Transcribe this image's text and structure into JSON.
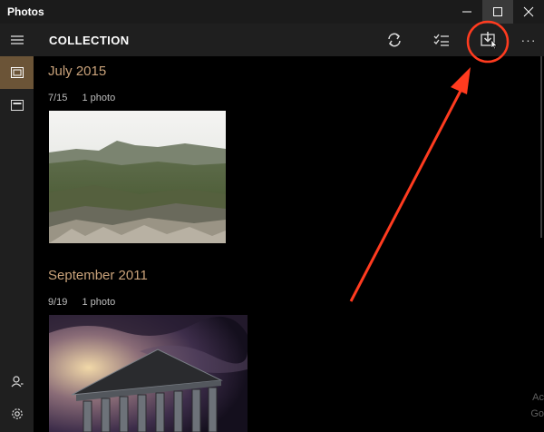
{
  "app": {
    "title": "Photos"
  },
  "header": {
    "title": "COLLECTION"
  },
  "toolbar": {
    "refresh_icon": "refresh-icon",
    "select_icon": "select-list-icon",
    "import_icon": "import-icon",
    "more_label": "···"
  },
  "sidebar": {
    "items": [
      {
        "icon": "collection-icon",
        "selected": true
      },
      {
        "icon": "albums-icon",
        "selected": false
      },
      {
        "icon": "account-icon",
        "selected": false
      },
      {
        "icon": "settings-icon",
        "selected": false
      }
    ]
  },
  "groups": [
    {
      "title": "July 2015",
      "date": "7/15",
      "count": "1 photo"
    },
    {
      "title": "September 2011",
      "date": "9/19",
      "count": "1 photo"
    }
  ],
  "watermark": {
    "line1": "Ac",
    "line2": "Go"
  },
  "colors": {
    "accent": "#c9a27a",
    "sidebar_selected": "#6b5437",
    "annotation": "#ff3b1f"
  }
}
